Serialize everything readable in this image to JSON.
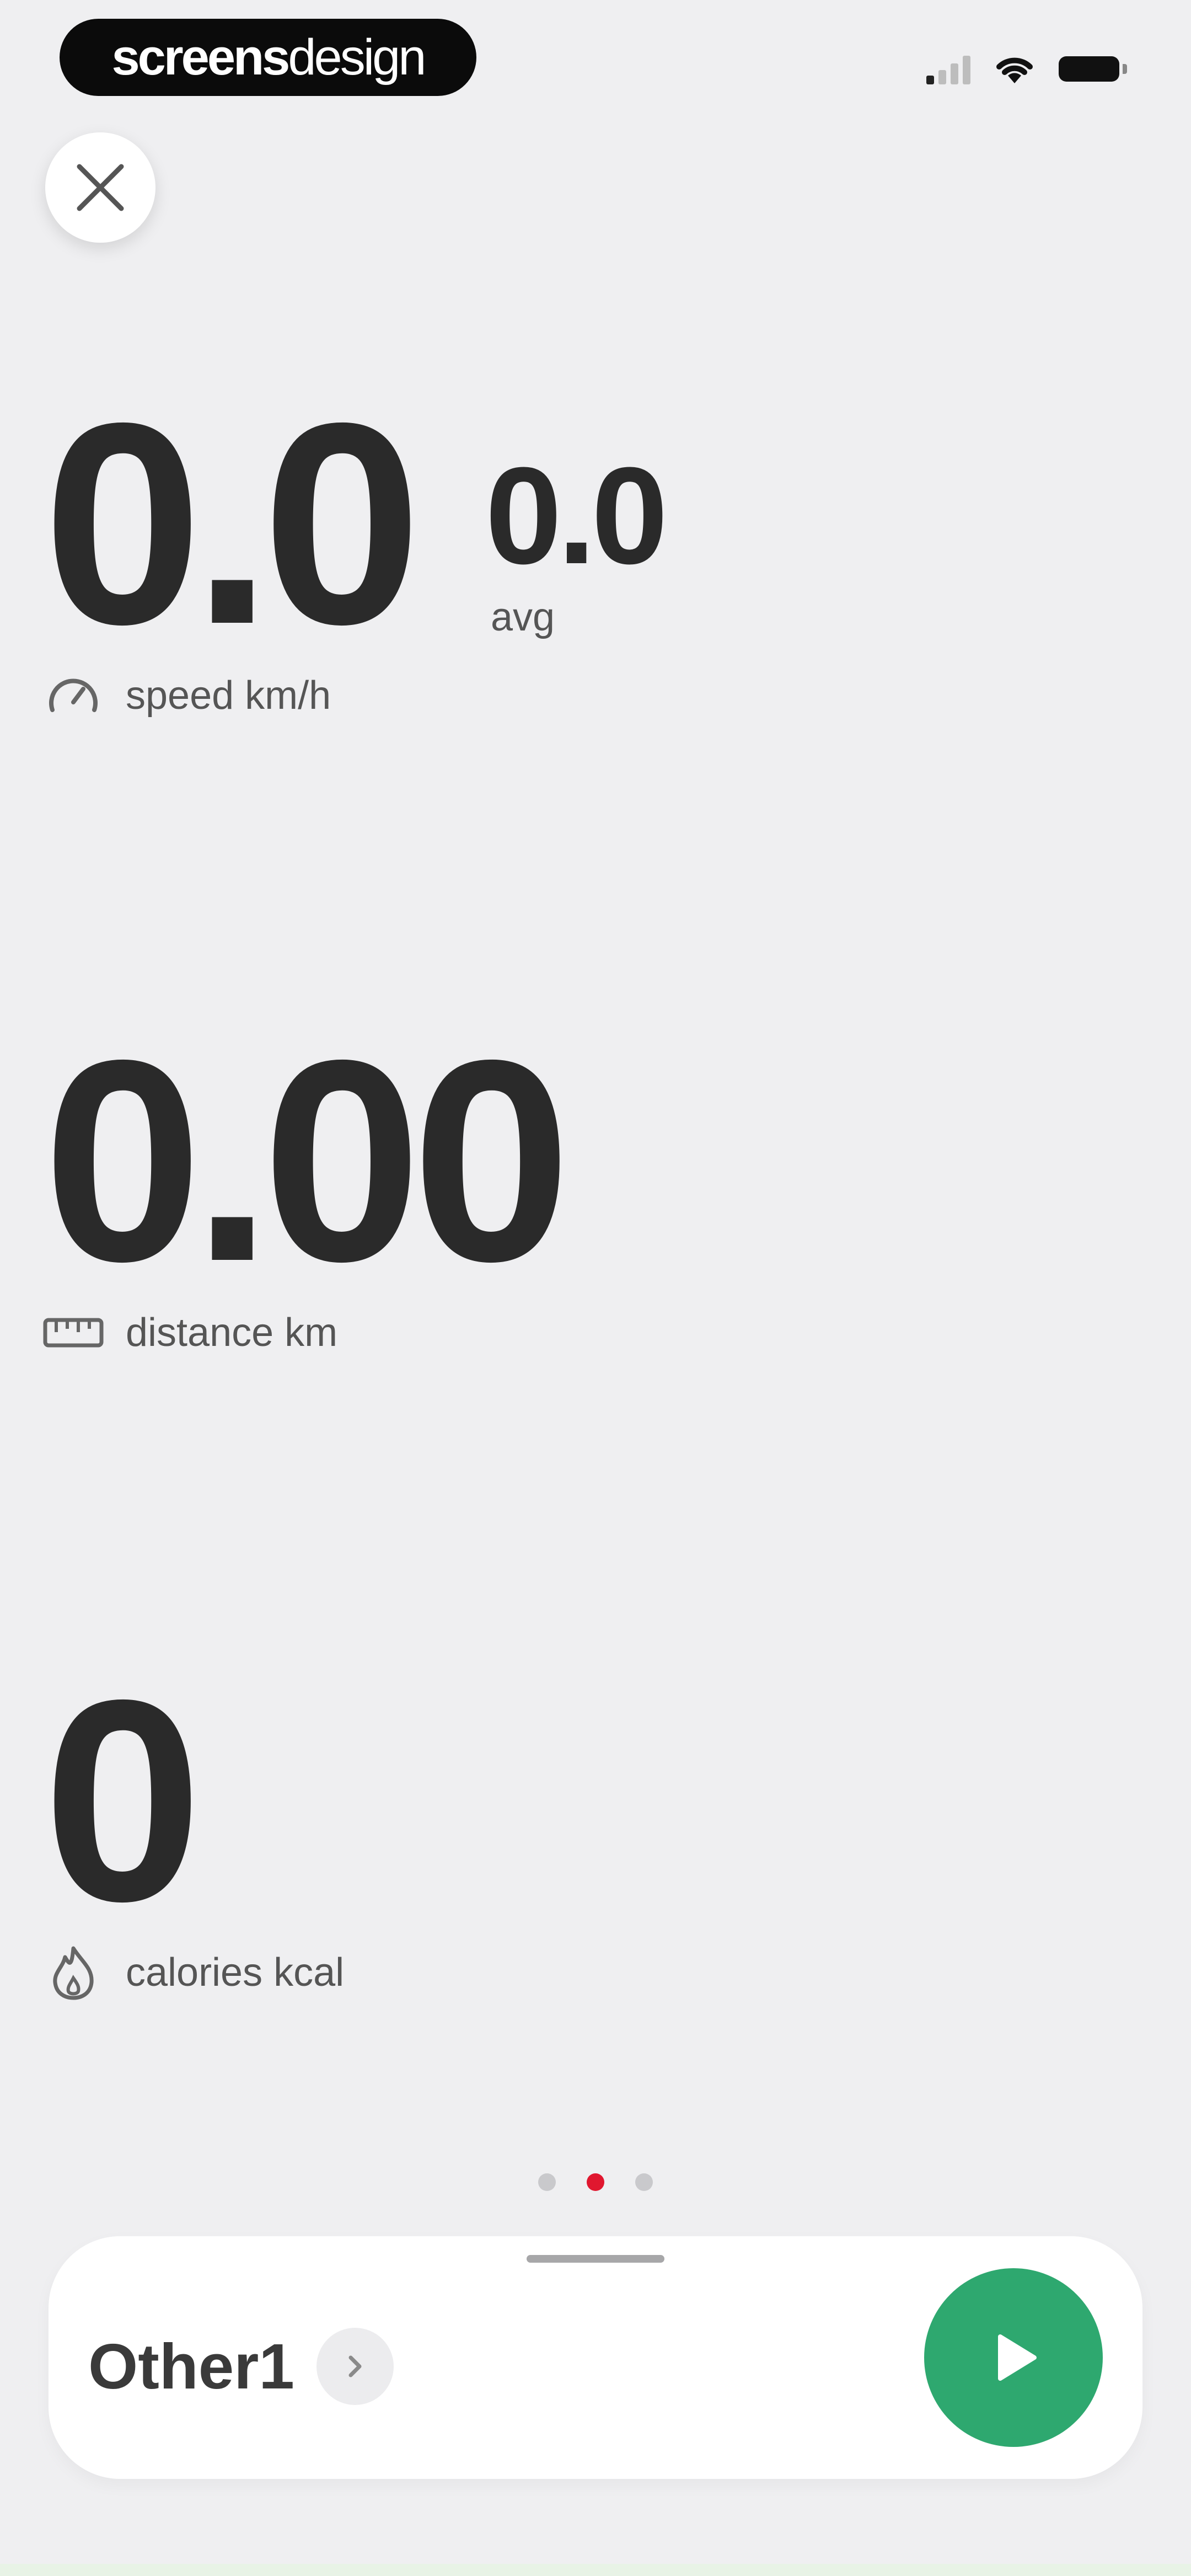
{
  "status_bar": {
    "brand_bold": "screens",
    "brand_light": "design"
  },
  "metrics": {
    "speed": {
      "value": "0.0",
      "label": "speed km/h",
      "icon": "speedometer-icon"
    },
    "avg": {
      "value": "0.0",
      "label": "avg"
    },
    "distance": {
      "value": "0.00",
      "label": "distance km",
      "icon": "ruler-icon"
    },
    "calories": {
      "value": "0",
      "label": "calories kcal",
      "icon": "flame-icon"
    }
  },
  "pager": {
    "pages": 3,
    "active_index": 1
  },
  "bottom_bar": {
    "activity_name": "Other1",
    "chevron_icon": "chevron-right-icon",
    "play_icon": "play-icon"
  },
  "colors": {
    "background": "#efeff1",
    "accent_green": "#2ea86f",
    "active_dot": "#e0172f"
  }
}
